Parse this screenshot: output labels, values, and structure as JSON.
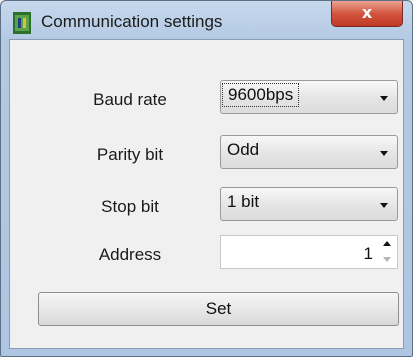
{
  "window": {
    "title": "Communication settings",
    "close_label": "x",
    "icon": "app-icon"
  },
  "form": {
    "baud_rate": {
      "label": "Baud rate",
      "value": "9600bps"
    },
    "parity_bit": {
      "label": "Parity bit",
      "value": "Odd"
    },
    "stop_bit": {
      "label": "Stop bit",
      "value": "1 bit"
    },
    "address": {
      "label": "Address",
      "value": "1"
    }
  },
  "actions": {
    "set_label": "Set"
  },
  "colors": {
    "titlebar": "#b3c9e3",
    "close": "#d4553f",
    "client": "#f0f0f0"
  }
}
